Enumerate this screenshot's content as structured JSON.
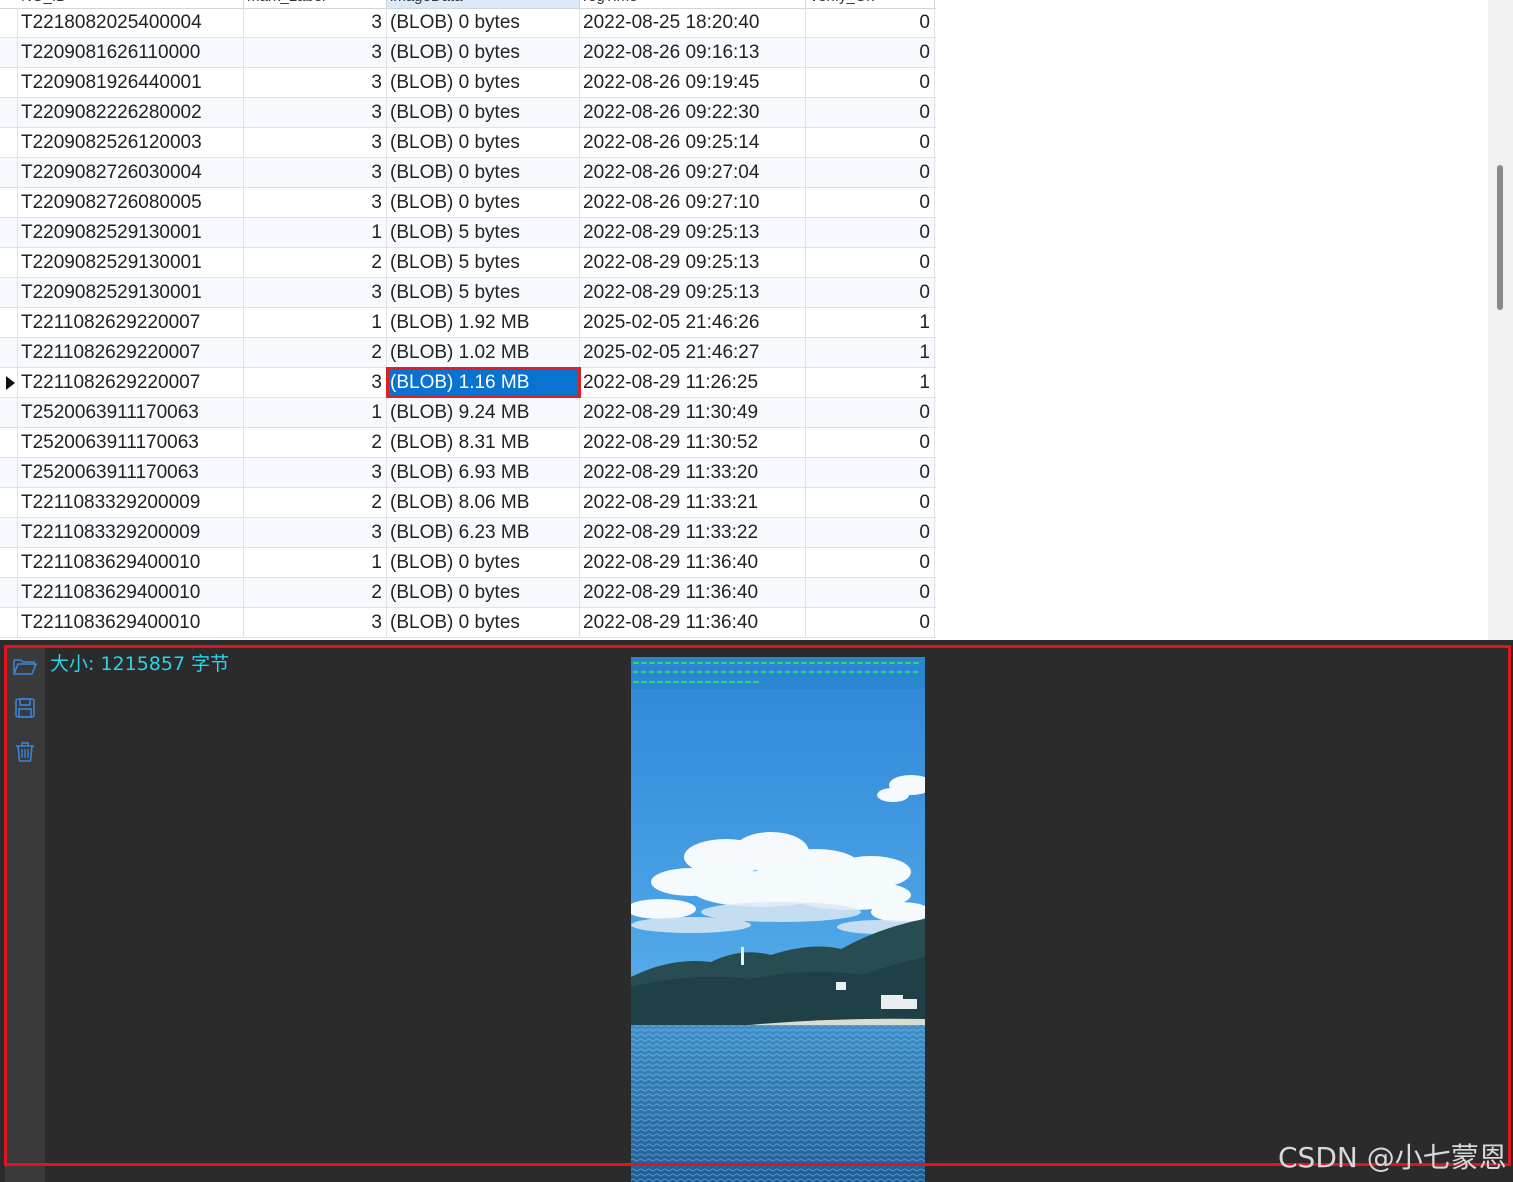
{
  "columns": [
    {
      "label": "NO_ID"
    },
    {
      "label": "mark_Label"
    },
    {
      "label": "imageData",
      "sorted": true
    },
    {
      "label": "regTime"
    },
    {
      "label": "Verify_Ok"
    }
  ],
  "rows": [
    {
      "id": "T2218082025400004",
      "label": "3",
      "data": "(BLOB) 0 bytes",
      "time": "2022-08-25 18:20:40",
      "verify": "0"
    },
    {
      "id": "T2209081626110000",
      "label": "3",
      "data": "(BLOB) 0 bytes",
      "time": "2022-08-26 09:16:13",
      "verify": "0"
    },
    {
      "id": "T2209081926440001",
      "label": "3",
      "data": "(BLOB) 0 bytes",
      "time": "2022-08-26 09:19:45",
      "verify": "0"
    },
    {
      "id": "T2209082226280002",
      "label": "3",
      "data": "(BLOB) 0 bytes",
      "time": "2022-08-26 09:22:30",
      "verify": "0"
    },
    {
      "id": "T2209082526120003",
      "label": "3",
      "data": "(BLOB) 0 bytes",
      "time": "2022-08-26 09:25:14",
      "verify": "0"
    },
    {
      "id": "T2209082726030004",
      "label": "3",
      "data": "(BLOB) 0 bytes",
      "time": "2022-08-26 09:27:04",
      "verify": "0"
    },
    {
      "id": "T2209082726080005",
      "label": "3",
      "data": "(BLOB) 0 bytes",
      "time": "2022-08-26 09:27:10",
      "verify": "0"
    },
    {
      "id": "T2209082529130001",
      "label": "1",
      "data": "(BLOB) 5 bytes",
      "time": "2022-08-29 09:25:13",
      "verify": "0"
    },
    {
      "id": "T2209082529130001",
      "label": "2",
      "data": "(BLOB) 5 bytes",
      "time": "2022-08-29 09:25:13",
      "verify": "0"
    },
    {
      "id": "T2209082529130001",
      "label": "3",
      "data": "(BLOB) 5 bytes",
      "time": "2022-08-29 09:25:13",
      "verify": "0"
    },
    {
      "id": "T2211082629220007",
      "label": "1",
      "data": "(BLOB) 1.92 MB",
      "time": "2025-02-05 21:46:26",
      "verify": "1"
    },
    {
      "id": "T2211082629220007",
      "label": "2",
      "data": "(BLOB) 1.02 MB",
      "time": "2025-02-05 21:46:27",
      "verify": "1"
    },
    {
      "id": "T2211082629220007",
      "label": "3",
      "data": "(BLOB) 1.16 MB",
      "time": "2022-08-29 11:26:25",
      "verify": "1",
      "selected": true
    },
    {
      "id": "T2520063911170063",
      "label": "1",
      "data": "(BLOB) 9.24 MB",
      "time": "2022-08-29 11:30:49",
      "verify": "0"
    },
    {
      "id": "T2520063911170063",
      "label": "2",
      "data": "(BLOB) 8.31 MB",
      "time": "2022-08-29 11:30:52",
      "verify": "0"
    },
    {
      "id": "T2520063911170063",
      "label": "3",
      "data": "(BLOB) 6.93 MB",
      "time": "2022-08-29 11:33:20",
      "verify": "0"
    },
    {
      "id": "T2211083329200009",
      "label": "2",
      "data": "(BLOB) 8.06 MB",
      "time": "2022-08-29 11:33:21",
      "verify": "0"
    },
    {
      "id": "T2211083329200009",
      "label": "3",
      "data": "(BLOB) 6.23 MB",
      "time": "2022-08-29 11:33:22",
      "verify": "0"
    },
    {
      "id": "T2211083629400010",
      "label": "1",
      "data": "(BLOB) 0 bytes",
      "time": "2022-08-29 11:36:40",
      "verify": "0"
    },
    {
      "id": "T2211083629400010",
      "label": "2",
      "data": "(BLOB) 0 bytes",
      "time": "2022-08-29 11:36:40",
      "verify": "0"
    },
    {
      "id": "T2211083629400010",
      "label": "3",
      "data": "(BLOB) 0 bytes",
      "time": "2022-08-29 11:36:40",
      "verify": "0"
    }
  ],
  "viewer": {
    "size_label": "大小: 1215857 字节",
    "toolbar_icons": [
      "folder-open-icon",
      "save-icon",
      "trash-icon"
    ],
    "preview_icon": "seascape-photo-icon"
  },
  "watermark": "CSDN @小七蒙恩",
  "colors": {
    "selection": "#0a72d0",
    "highlight_border": "#e0141e",
    "viewer_bg": "#2b2b2b",
    "size_label": "#2ad3e8"
  }
}
